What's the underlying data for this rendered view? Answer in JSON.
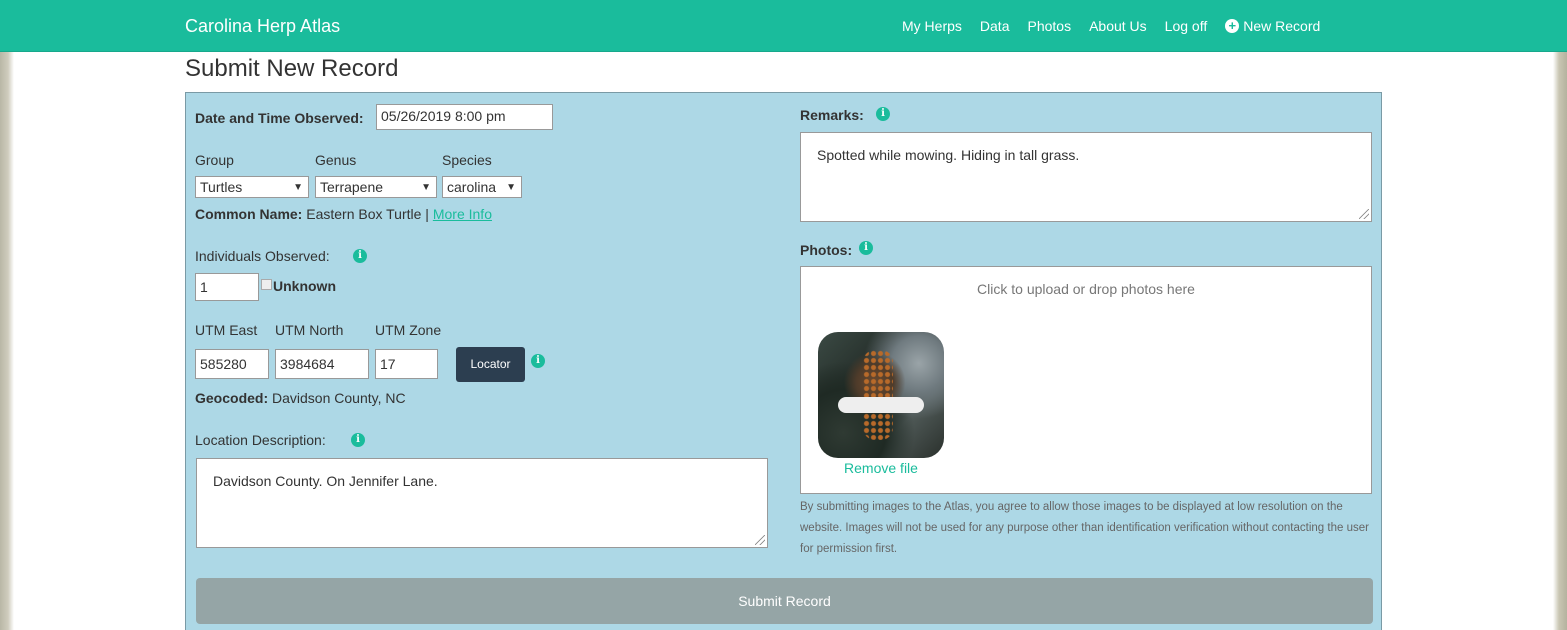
{
  "navbar": {
    "brand": "Carolina Herp Atlas",
    "items": [
      "My Herps",
      "Data",
      "Photos",
      "About Us",
      "Log off"
    ],
    "new_record": "New Record"
  },
  "page_title": "Submit New Record",
  "form": {
    "date_label": "Date and Time Observed:",
    "date_value": "05/26/2019 8:00 pm",
    "group_label": "Group",
    "genus_label": "Genus",
    "species_label": "Species",
    "group_value": "Turtles",
    "genus_value": "Terrapene",
    "species_value": "carolina",
    "common_name_label": "Common Name:",
    "common_name_value": "Eastern Box Turtle |",
    "more_info": "More Info",
    "individuals_label": "Individuals Observed:",
    "individuals_value": "1",
    "unknown_label": "Unknown",
    "utm_east_label": "UTM East",
    "utm_north_label": "UTM North",
    "utm_zone_label": "UTM Zone",
    "utm_east_value": "585280",
    "utm_north_value": "3984684",
    "utm_zone_value": "17",
    "locator_label": "Locator",
    "geocoded_label": "Geocoded:",
    "geocoded_value": "Davidson County, NC",
    "location_label": "Location Description:",
    "location_value": "Davidson County. On Jennifer Lane.",
    "remarks_label": "Remarks:",
    "remarks_value": "Spotted while mowing. Hiding in tall grass.",
    "photos_label": "Photos:",
    "dropzone_msg": "Click to upload or drop photos here",
    "remove_file": "Remove file",
    "disclaimer": "By submitting images to the Atlas, you agree to allow those images to be displayed at low resolution on the website. Images will not be used for any purpose other than identification verification without contacting the user for permission first.",
    "submit_label": "Submit Record"
  },
  "icons": {
    "info": "info-icon",
    "plus": "plus-circle-icon",
    "dropdown": "dropdown-arrow-icon"
  },
  "colors": {
    "navbar": "#1abc9c",
    "panel": "#add8e6",
    "locator_button": "#2c3e50",
    "submit_button": "#95a5a6"
  }
}
